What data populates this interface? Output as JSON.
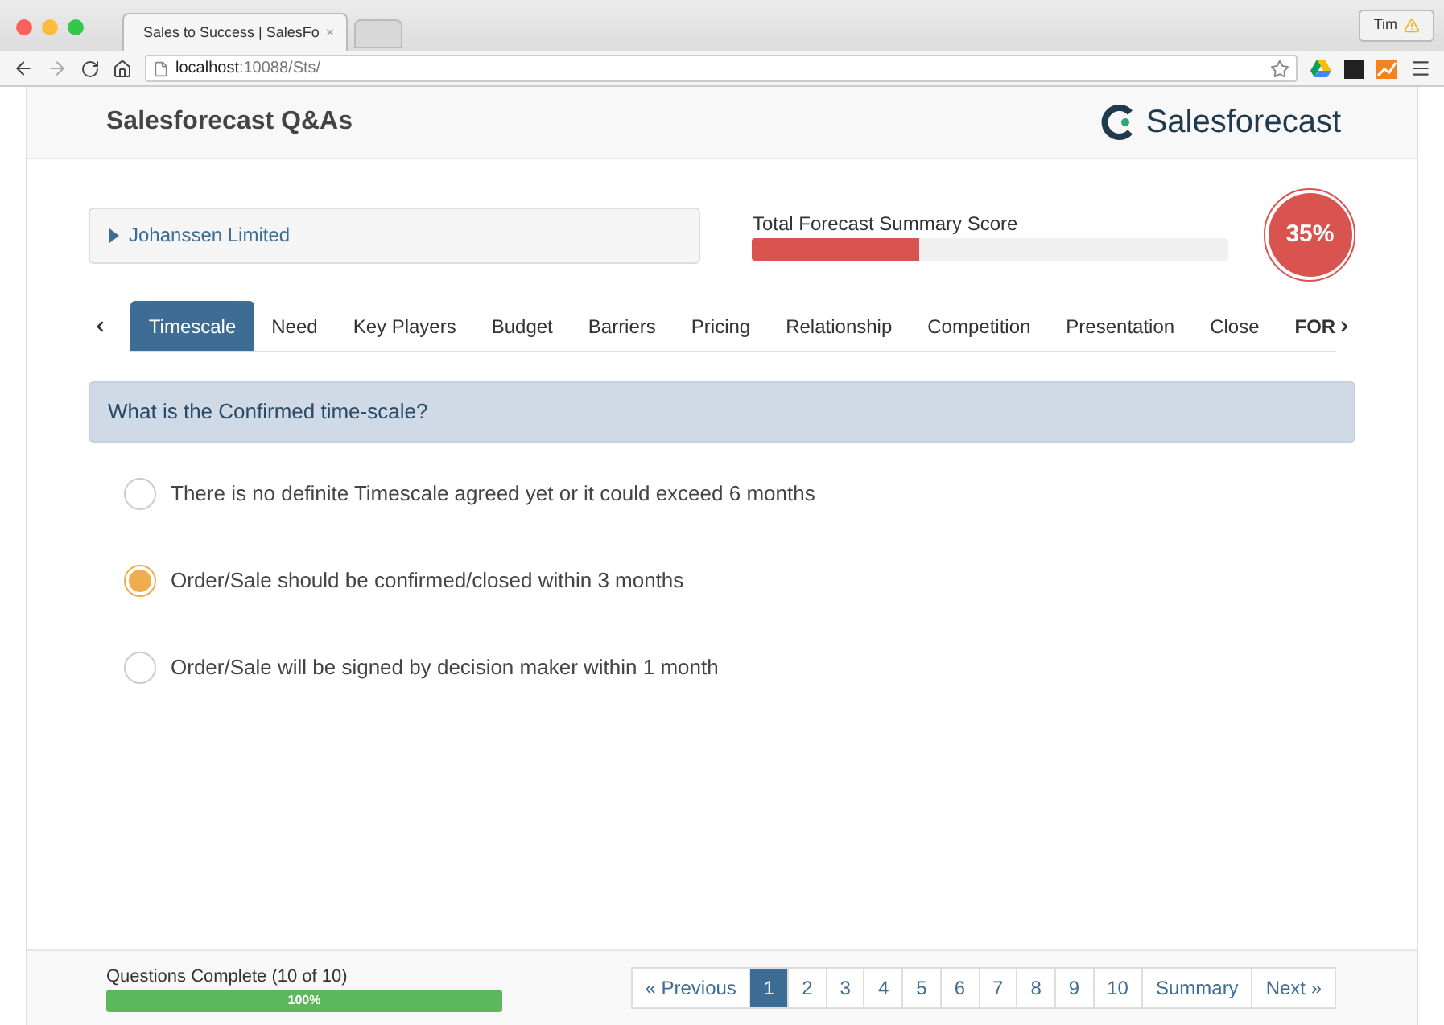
{
  "browser": {
    "tab_title": "Sales to Success | SalesFo",
    "close": "×",
    "url_host": "localhost",
    "url_path": ":10088/Sts/",
    "user": "Tim"
  },
  "header": {
    "title": "Salesforecast Q&As",
    "logo_text": "Salesforecast"
  },
  "account": {
    "name": "Johanssen Limited"
  },
  "score": {
    "label": "Total Forecast Summary Score",
    "level": 0.35,
    "value": "35%"
  },
  "tabs": [
    {
      "label": "Timescale",
      "selected": true
    },
    {
      "label": "Need",
      "selected": false
    },
    {
      "label": "Key Players",
      "selected": false
    },
    {
      "label": "Budget",
      "selected": false
    },
    {
      "label": "Barriers",
      "selected": false
    },
    {
      "label": "Pricing",
      "selected": false
    },
    {
      "label": "Relationship",
      "selected": false
    },
    {
      "label": "Competition",
      "selected": false
    },
    {
      "label": "Presentation",
      "selected": false
    },
    {
      "label": "Close",
      "selected": false
    },
    {
      "label": "FOR",
      "selected": false
    }
  ],
  "question": "What is the Confirmed time-scale?",
  "options": [
    {
      "label": "There is no definite Timescale agreed yet or it could exceed 6 months",
      "selected": false
    },
    {
      "label": "Order/Sale should be confirmed/closed within 3 months",
      "selected": true
    },
    {
      "label": "Order/Sale will be signed by decision maker within 1 month",
      "selected": false
    }
  ],
  "progress": {
    "label": "Questions Complete (10 of 10)",
    "level": 1,
    "value": "100%"
  },
  "pagination": [
    {
      "label": "« Previous",
      "selected": false
    },
    {
      "label": "1",
      "selected": true
    },
    {
      "label": "2",
      "selected": false
    },
    {
      "label": "3",
      "selected": false
    },
    {
      "label": "4",
      "selected": false
    },
    {
      "label": "5",
      "selected": false
    },
    {
      "label": "6",
      "selected": false
    },
    {
      "label": "7",
      "selected": false
    },
    {
      "label": "8",
      "selected": false
    },
    {
      "label": "9",
      "selected": false
    },
    {
      "label": "10",
      "selected": false
    },
    {
      "label": "Summary",
      "selected": false
    },
    {
      "label": "Next »",
      "selected": false
    }
  ]
}
